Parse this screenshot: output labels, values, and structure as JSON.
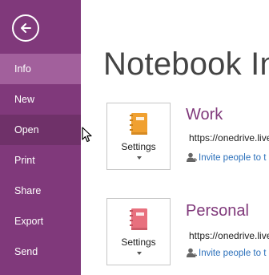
{
  "sidebar": {
    "back_icon": "back-arrow-icon",
    "items": [
      {
        "label": "Info",
        "state": "selected"
      },
      {
        "label": "New",
        "state": "normal"
      },
      {
        "label": "Open",
        "state": "hover"
      },
      {
        "label": "Print",
        "state": "normal"
      },
      {
        "label": "Share",
        "state": "normal"
      },
      {
        "label": "Export",
        "state": "normal"
      },
      {
        "label": "Send",
        "state": "normal"
      }
    ]
  },
  "main": {
    "title": "Notebook In",
    "notebooks": [
      {
        "name": "Work",
        "settings_label": "Settings",
        "url": "https://onedrive.live",
        "invite": "Invite people to t",
        "icon": "orange-notebook-icon",
        "color": "#f0a030"
      },
      {
        "name": "Personal",
        "settings_label": "Settings",
        "url": "https://onedrive.live",
        "invite": "Invite people to t",
        "icon": "pink-notebook-icon",
        "color": "#e8707e"
      }
    ]
  },
  "colors": {
    "sidebar": "#80397b",
    "sidebar_selected": "#a2609c",
    "accent": "#80397b",
    "link": "#2a6fba"
  }
}
